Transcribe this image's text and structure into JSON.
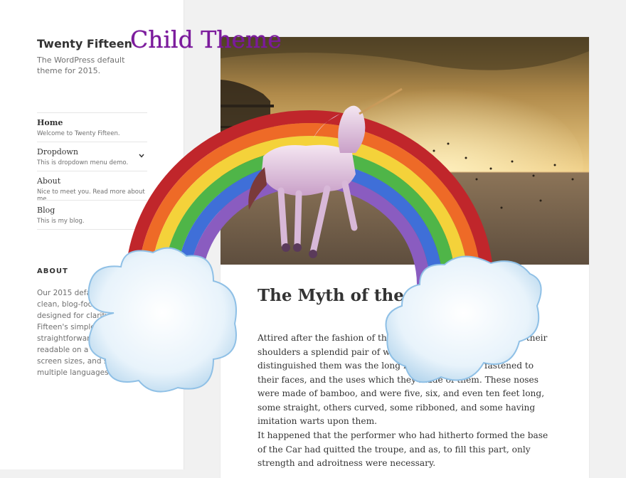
{
  "site": {
    "title": "Twenty Fifteen",
    "child_theme_label": "Child Theme",
    "description": "The WordPress default theme for 2015."
  },
  "menu": {
    "items": [
      {
        "label": "Home",
        "desc": "Welcome to Twenty Fifteen.",
        "current": true
      },
      {
        "label": "Dropdown",
        "desc": "This is dropdown menu demo.",
        "has_children": true
      },
      {
        "label": "About",
        "desc": "Nice to meet you. Read more about me."
      },
      {
        "label": "Blog",
        "desc": "This is my blog."
      }
    ],
    "dropdown_icon": "chevron-down-icon"
  },
  "widget": {
    "title": "ABOUT",
    "text": "Our 2015 default theme is clean, blog-focused, and designed for clarity. Twenty Fifteen's simple, straightforward typography is readable on a wide variety of screen sizes, and suitable for multiple languages."
  },
  "post": {
    "title": "The Myth of the Pegasus",
    "paragraphs": [
      "Attired after the fashion of the Middle Ages, they wore upon their shoulders a splendid pair of wings; but what especially distinguished them was the long noses which were fastened to their faces, and the uses which they made of them. These noses were made of bamboo, and were five, six, and even ten feet long, some straight, others curved, some ribboned, and some having imitation warts upon them.",
      "It happened that the performer who had hitherto formed the base of the Car had quitted the troupe, and as, to fill this part, only strength and adroitness were necessary."
    ]
  },
  "colors": {
    "child_theme": "#7b1a9c",
    "sidebar_bg": "#ffffff",
    "page_bg": "#f1f1f1"
  }
}
